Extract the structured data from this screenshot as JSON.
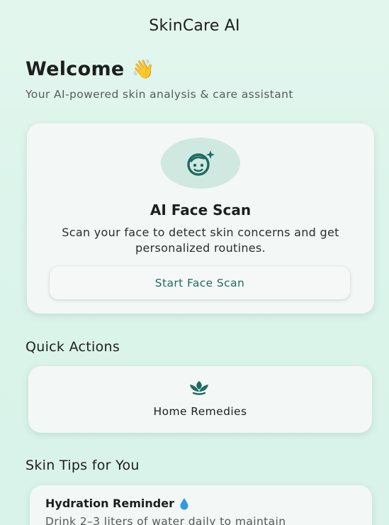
{
  "app": {
    "title": "SkinCare AI"
  },
  "welcome": {
    "title": "Welcome",
    "emoji": "👋",
    "subtitle": "Your AI-powered skin analysis & care assistant"
  },
  "scan_card": {
    "icon": "face-scan-icon",
    "title": "AI Face Scan",
    "description": "Scan your face to detect skin concerns and get personalized routines.",
    "button_label": "Start Face Scan"
  },
  "quick_actions": {
    "heading": "Quick Actions",
    "items": [
      {
        "label": "Home Remedies",
        "icon": "leaf-icon"
      }
    ]
  },
  "skin_tips": {
    "heading": "Skin Tips for You",
    "items": [
      {
        "title": "Hydration Reminder",
        "icon": "water-drop-icon",
        "body": "Drink 2–3 liters of water daily to maintain"
      }
    ]
  },
  "colors": {
    "accent": "#1f6b62",
    "background": "#dff5ec",
    "icon_circle": "#cfe9e1",
    "drop": "#2f9be0"
  }
}
